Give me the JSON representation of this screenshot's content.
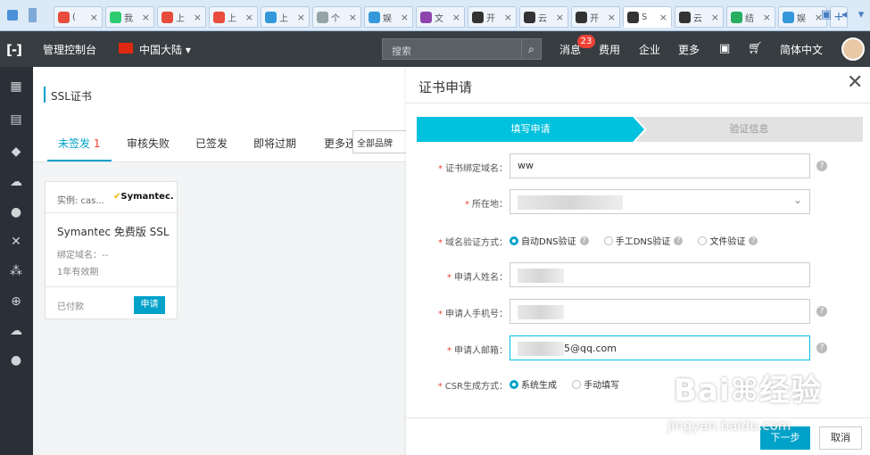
{
  "browser": {
    "tabs": [
      {
        "label": "(",
        "color": "#e74c3c"
      },
      {
        "label": "我",
        "color": "#2ecc71"
      },
      {
        "label": "上",
        "color": "#e74c3c"
      },
      {
        "label": "上",
        "color": "#e74c3c"
      },
      {
        "label": "上",
        "color": "#3498db"
      },
      {
        "label": "个",
        "color": "#95a5a6"
      },
      {
        "label": "娱",
        "color": "#3498db"
      },
      {
        "label": "文",
        "color": "#8e44ad"
      },
      {
        "label": "开",
        "color": "#333333"
      },
      {
        "label": "云",
        "color": "#333333"
      },
      {
        "label": "开",
        "color": "#333333"
      },
      {
        "label": "S",
        "color": "#333333"
      },
      {
        "label": "云",
        "color": "#333333"
      },
      {
        "label": "结",
        "color": "#27ae60"
      },
      {
        "label": "娱",
        "color": "#3498db"
      }
    ],
    "new_tab": "+"
  },
  "topnav": {
    "logo": "[-]",
    "console": "管理控制台",
    "region": "中国大陆 ▾",
    "search_placeholder": "搜索",
    "messages": "消息",
    "messages_badge": "23",
    "fees": "费用",
    "enterprise": "企业",
    "more": "更多",
    "language": "简体中文"
  },
  "page": {
    "title": "SSL证书",
    "tabs": {
      "unissued": "未签发",
      "unissued_count": "1",
      "failed": "审核失败",
      "issued": "已签发",
      "expiring": "即将过期",
      "more": "更多还"
    },
    "brand_filter": "全部品牌"
  },
  "card": {
    "example": "实例: cas...",
    "brand": "Symantec.",
    "name": "Symantec 免费版 SSL",
    "bind_domain": "绑定域名：--",
    "validity": "1年有效期",
    "paid": "已付款",
    "apply": "申请"
  },
  "dialog": {
    "title": "证书申请",
    "step1": "填写申请",
    "step2": "验证信息",
    "fields": {
      "domain_label": "证书绑定域名：",
      "domain_value": "ww",
      "location_label": "所在地：",
      "verify_label": "域名验证方式：",
      "verify_dns_auto": "自动DNS验证",
      "verify_dns_manual": "手工DNS验证",
      "verify_file": "文件验证",
      "name_label": "申请人姓名：",
      "phone_label": "申请人手机号：",
      "email_label": "申请人邮箱：",
      "email_value": "5@qq.com",
      "csr_label": "CSR生成方式：",
      "csr_system": "系统生成",
      "csr_manual": "手动填写"
    },
    "next": "下一步",
    "cancel": "取消"
  },
  "watermark": {
    "line1": "Bai⌘经验",
    "line2": "jingyan.baidu.com"
  },
  "colors": {
    "accent": "#00a2ca",
    "step_active": "#00c1de",
    "topnav_bg": "#373d41",
    "sidebar_bg": "#293038"
  }
}
